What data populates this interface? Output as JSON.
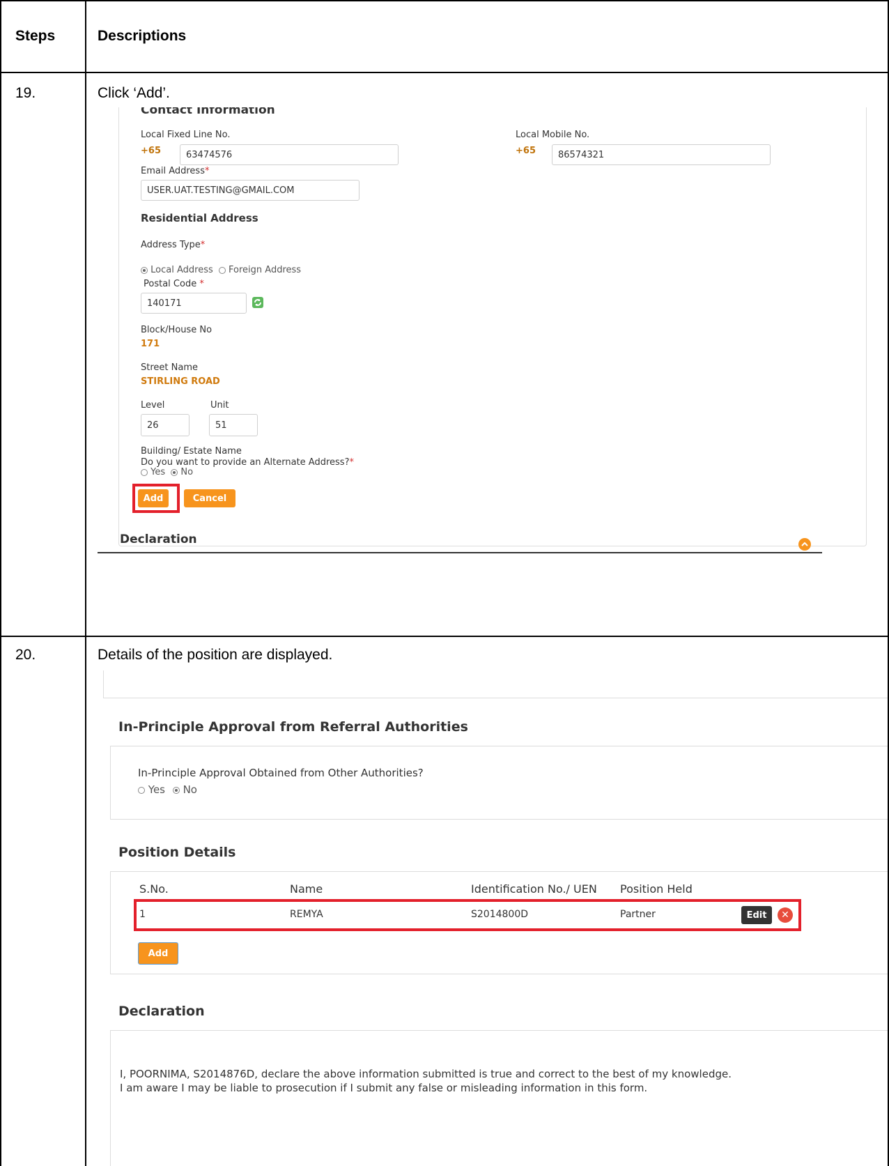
{
  "table": {
    "header": {
      "steps": "Steps",
      "descriptions": "Descriptions"
    },
    "rows": [
      {
        "step": "19.",
        "description": "Click ‘Add’."
      },
      {
        "step": "20.",
        "description": "Details of the position are displayed."
      }
    ]
  },
  "screen1": {
    "section_title": "Contact Information",
    "local_fixed_label": "Local Fixed Line No.",
    "local_fixed_prefix": "+65",
    "local_fixed_value": "63474576",
    "mobile_label": "Local Mobile No.",
    "mobile_prefix": "+65",
    "mobile_value": "86574321",
    "email_label": "Email Address",
    "required_mark": "*",
    "email_value": "USER.UAT.TESTING@GMAIL.COM",
    "residential_title": "Residential Address",
    "address_type_label": "Address Type",
    "local_address_label": "Local Address",
    "foreign_address_label": "Foreign Address",
    "postal_code_label": "Postal Code",
    "postal_code_value": "140171",
    "block_label": "Block/House No",
    "block_value": "171",
    "street_label": "Street Name",
    "street_value": "STIRLING ROAD",
    "level_label": "Level",
    "level_value": "26",
    "unit_label": "Unit",
    "unit_value": "51",
    "building_label": "Building/ Estate Name",
    "alternate_question": "Do you want to provide an Alternate Address?",
    "yes_label": "Yes",
    "no_label": "No",
    "add_button": "Add",
    "cancel_button": "Cancel",
    "declaration_title": "Declaration",
    "refresh_icon": "refresh-icon",
    "collapse_icon": "chevron-up-circle-icon",
    "colors": {
      "accent": "#f7941d",
      "highlight": "#e3202b",
      "value_text": "#d07a0d"
    }
  },
  "screen2": {
    "ipa_title": "In-Principle Approval from Referral Authorities",
    "ipa_question": "In-Principle Approval Obtained from Other Authorities?",
    "yes_label": "Yes",
    "no_label": "No",
    "position_title": "Position Details",
    "columns": [
      "S.No.",
      "Name",
      "Identification No./ UEN",
      "Position Held"
    ],
    "row": {
      "sno": "1",
      "name": "REMYA",
      "id": "S2014800D",
      "position": "Partner"
    },
    "edit_button": "Edit",
    "delete_icon": "delete-icon",
    "add_button": "Add",
    "declaration_title": "Declaration",
    "declaration_line1": "I, POORNIMA, S2014876D, declare the above information submitted is true and correct to the best of my knowledge.",
    "declaration_line2": "I am aware I may be liable to prosecution if I submit any false or misleading information in this form."
  }
}
